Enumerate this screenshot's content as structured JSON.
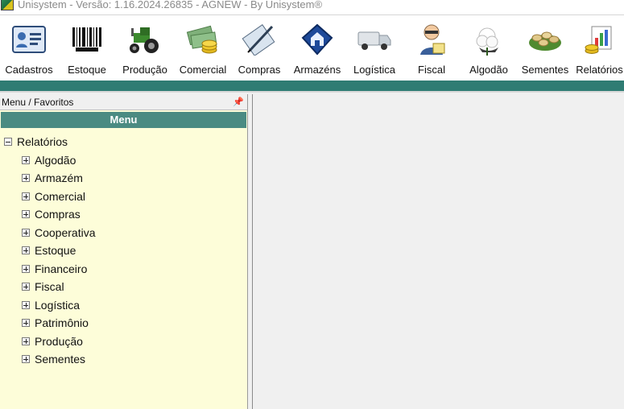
{
  "window": {
    "title": "Unisystem - Versão: 1.16.2024.26835 - AGNEW - By Unisystem®"
  },
  "toolbar": {
    "items": [
      {
        "label": "Cadastros",
        "icon": "id-card-icon"
      },
      {
        "label": "Estoque",
        "icon": "barcode-icon"
      },
      {
        "label": "Produção",
        "icon": "tractor-icon"
      },
      {
        "label": "Comercial",
        "icon": "money-coins-icon"
      },
      {
        "label": "Compras",
        "icon": "pen-paper-icon"
      },
      {
        "label": "Armazéns",
        "icon": "house-arrow-icon"
      },
      {
        "label": "Logística",
        "icon": "truck-icon"
      },
      {
        "label": "Fiscal",
        "icon": "inspector-icon"
      },
      {
        "label": "Algodão",
        "icon": "cotton-icon"
      },
      {
        "label": "Sementes",
        "icon": "seeds-icon"
      },
      {
        "label": "Relatórios",
        "icon": "report-chart-icon"
      }
    ]
  },
  "panel": {
    "header": "Menu / Favoritos",
    "pin": "ฺ",
    "menu_title": "Menu",
    "root": "Relatórios",
    "items": [
      "Algodão",
      "Armazém",
      "Comercial",
      "Compras",
      "Cooperativa",
      "Estoque",
      "Financeiro",
      "Fiscal",
      "Logística",
      "Patrimônio",
      "Produção",
      "Sementes"
    ]
  },
  "colors": {
    "accent": "#2f7c73",
    "menu_bar": "#4b8b82",
    "panel_bg": "#fdfdd9"
  }
}
